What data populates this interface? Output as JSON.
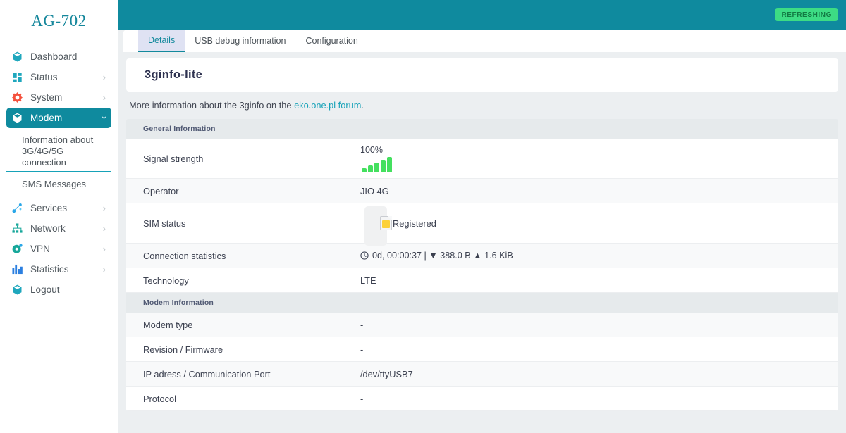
{
  "brand": {
    "title": "AG-702"
  },
  "topbar": {
    "refresh_badge": "REFRESHING"
  },
  "sidebar": {
    "items": [
      {
        "label": "Dashboard",
        "icon": "cube-icon",
        "chevron": "",
        "active": false
      },
      {
        "label": "Status",
        "icon": "grid-icon",
        "chevron": "›",
        "active": false
      },
      {
        "label": "System",
        "icon": "gear-icon",
        "chevron": "›",
        "active": false
      },
      {
        "label": "Modem",
        "icon": "cube-icon",
        "chevron": "›",
        "active": true
      },
      {
        "label": "Services",
        "icon": "nodes-icon",
        "chevron": "›",
        "active": false
      },
      {
        "label": "Network",
        "icon": "network-tree-icon",
        "chevron": "›",
        "active": false
      },
      {
        "label": "VPN",
        "icon": "globe-shield-icon",
        "chevron": "›",
        "active": false
      },
      {
        "label": "Statistics",
        "icon": "bar-chart-icon",
        "chevron": "›",
        "active": false
      },
      {
        "label": "Logout",
        "icon": "cube-icon",
        "chevron": "",
        "active": false
      }
    ],
    "submenu": [
      {
        "label": "Information about 3G/4G/5G connection",
        "active": true
      },
      {
        "label": "SMS Messages",
        "active": false
      }
    ]
  },
  "tabs": [
    {
      "label": "Details",
      "active": true
    },
    {
      "label": "USB debug information",
      "active": false
    },
    {
      "label": "Configuration",
      "active": false
    }
  ],
  "page": {
    "title": "3ginfo-lite",
    "info_prefix": "More information about the 3ginfo on the ",
    "info_link": "eko.one.pl forum",
    "info_suffix": "."
  },
  "sections": [
    {
      "heading": "General Information",
      "rows": [
        {
          "key": "Signal strength",
          "type": "signal",
          "percent": "100%",
          "bars": [
            6,
            10,
            14,
            18,
            22
          ]
        },
        {
          "key": "Operator",
          "type": "text",
          "value": "JIO 4G"
        },
        {
          "key": "SIM status",
          "type": "sim",
          "value": "Registered"
        },
        {
          "key": "Connection statistics",
          "type": "conn",
          "value": "0d, 00:00:37 | ▼ 388.0 B ▲ 1.6 KiB"
        },
        {
          "key": "Technology",
          "type": "text",
          "value": "LTE"
        }
      ]
    },
    {
      "heading": "Modem Information",
      "rows": [
        {
          "key": "Modem type",
          "type": "text",
          "value": "-"
        },
        {
          "key": "Revision / Firmware",
          "type": "text",
          "value": "-"
        },
        {
          "key": "IP adress / Communication Port",
          "type": "text",
          "value": "/dev/ttyUSB7"
        },
        {
          "key": "Protocol",
          "type": "text",
          "value": "-"
        }
      ]
    }
  ],
  "colors": {
    "teal": "#0f8a9e",
    "teal_link": "#16a2b8",
    "green_badge_bg": "#3ddc84",
    "green_badge_text": "#127a43",
    "signal_green": "#44e05f",
    "sim_chip": "#fcd13a",
    "tab_active_bg": "#dfe2f3",
    "section_head_bg": "#e6eaec",
    "page_bg": "#eceff1"
  }
}
